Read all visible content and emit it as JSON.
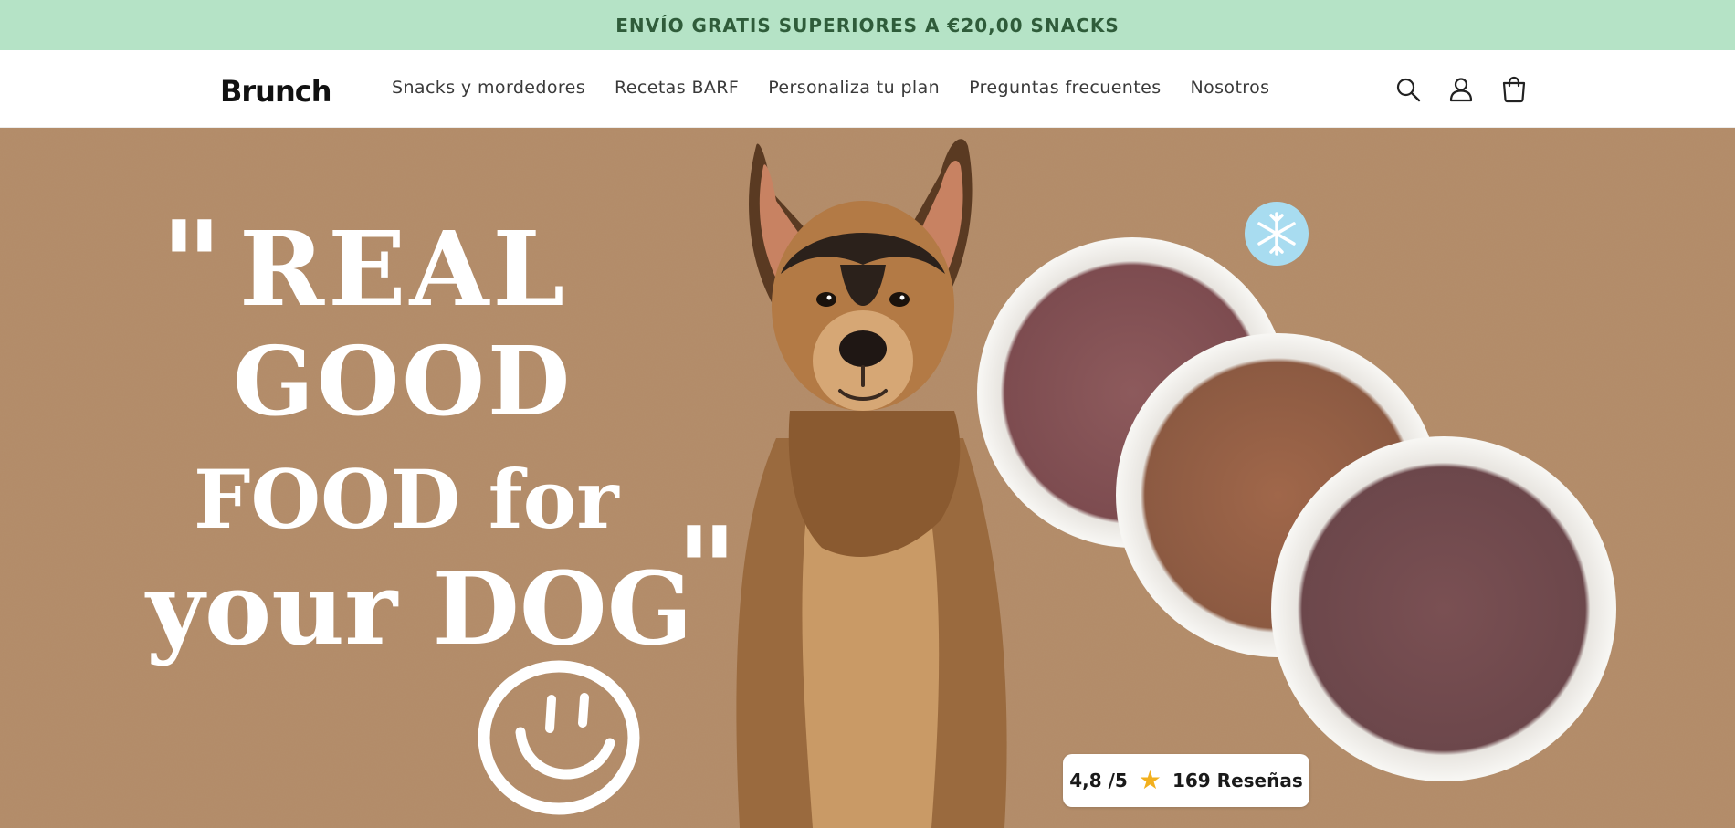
{
  "announcement": {
    "text": "ENVÍO GRATIS SUPERIORES A €20,00 SNACKS",
    "background": "#b5e3c6",
    "color": "#2f5c3a"
  },
  "header": {
    "logo_text": "Brunch",
    "nav": [
      {
        "label": "Snacks y mordedores"
      },
      {
        "label": "Recetas BARF"
      },
      {
        "label": "Personaliza tu plan"
      },
      {
        "label": "Preguntas frecuentes"
      },
      {
        "label": "Nosotros"
      }
    ],
    "icons": [
      "search-icon",
      "account-icon",
      "cart-icon"
    ]
  },
  "hero": {
    "background": "#b38b67",
    "headline": {
      "open_quote": "\"",
      "line1": "REAL",
      "line2": "GOOD",
      "line3": "FOOD for",
      "line4": "your DOG",
      "close_quote": "\""
    },
    "badge_icon": "snowflake-icon",
    "badge_color": "#a8dcf0",
    "rating": {
      "score": "4,8 /5",
      "star_color": "#f2b01e",
      "reviews": "169 Reseñas"
    }
  }
}
